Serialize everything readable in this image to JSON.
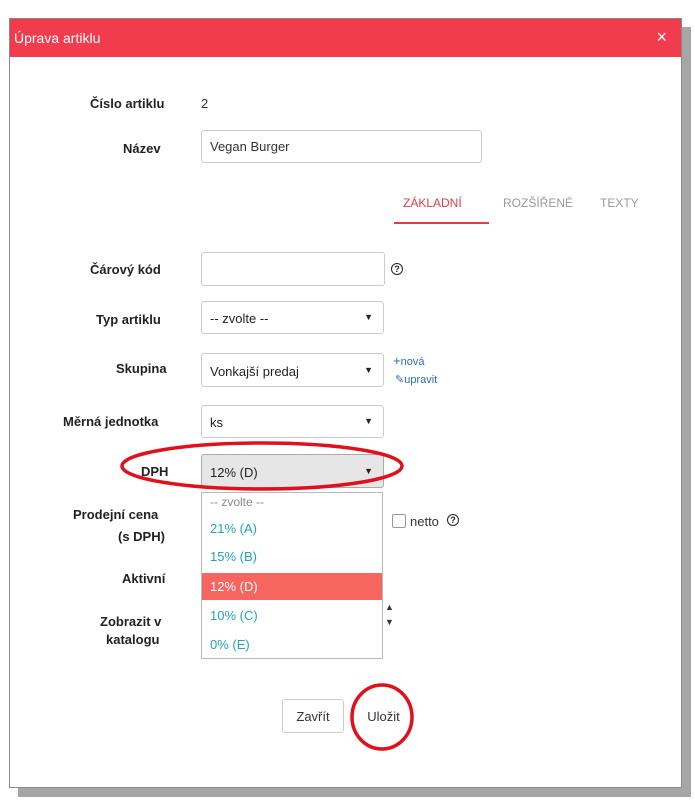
{
  "header": {
    "title": "Úprava artiklu",
    "close": "×"
  },
  "fields": {
    "cislo_label": "Číslo artiklu",
    "cislo_value": "2",
    "nazev_label": "Název",
    "nazev_value": "Vegan Burger",
    "carovy_label": "Čárový kód",
    "carovy_value": "",
    "typ_label": "Typ artiklu",
    "typ_value": "-- zvolte --",
    "skupina_label": "Skupina",
    "skupina_value": "Vonkajší predaj",
    "skupina_new": "nová",
    "skupina_edit": "upravit",
    "mj_label": "Měrná jednotka",
    "mj_value": "ks",
    "dph_label": "DPH",
    "dph_value": "12% (D)",
    "cena_label_1": "Prodejní cena",
    "cena_label_2": "(s DPH)",
    "netto_label": "netto",
    "aktivni_label": "Aktivní",
    "katalog_label_1": "Zobrazit v",
    "katalog_label_2": "katalogu"
  },
  "tabs": [
    {
      "label": "ZÁKLADNÍ",
      "active": true
    },
    {
      "label": "ROZŠÍŘENÉ",
      "active": false
    },
    {
      "label": "TEXTY",
      "active": false
    }
  ],
  "dph_options": [
    "-- zvolte --",
    "21% (A)",
    "15% (B)",
    "12% (D)",
    "10% (C)",
    "0% (E)"
  ],
  "dph_selected_index": 3,
  "buttons": {
    "close": "Zavřít",
    "save": "Uložit"
  },
  "colors": {
    "header": "#f23b4d",
    "accent": "#e33b47",
    "option_text": "#22a3b8",
    "selected_option": "#f66560",
    "annotation": "#e0101c"
  }
}
